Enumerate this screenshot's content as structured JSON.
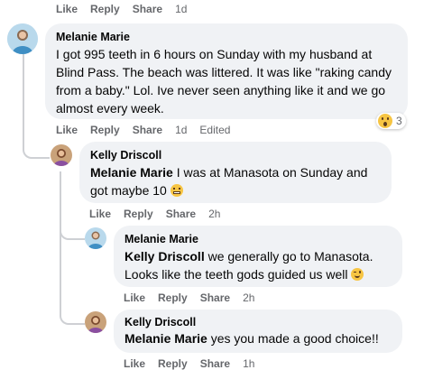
{
  "top_actions": {
    "like": "Like",
    "reply": "Reply",
    "share": "Share",
    "time": "1d"
  },
  "comments": [
    {
      "author": "Melanie Marie",
      "text": "I got 995 teeth in 6 hours on Sunday with my husband at Blind Pass. The beach was littered. It was like \"raking candy from a baby.\" Lol. Ive never seen anything like it and we go almost every week.",
      "reaction_count": "3",
      "like": "Like",
      "reply": "Reply",
      "share": "Share",
      "time": "1d",
      "edited": "Edited"
    },
    {
      "author": "Kelly Driscoll",
      "mention": "Melanie Marie",
      "text": " I was at Manasota on Sunday and got maybe 10 ",
      "like": "Like",
      "reply": "Reply",
      "share": "Share",
      "time": "2h"
    },
    {
      "author": "Melanie Marie",
      "mention": "Kelly Driscoll",
      "text": " we generally go to Manasota. Looks like the teeth gods guided us well ",
      "like": "Like",
      "reply": "Reply",
      "share": "Share",
      "time": "2h"
    },
    {
      "author": "Kelly Driscoll",
      "mention": "Melanie Marie",
      "text": " yes you made a good choice!!",
      "like": "Like",
      "reply": "Reply",
      "share": "Share",
      "time": "1h"
    }
  ]
}
